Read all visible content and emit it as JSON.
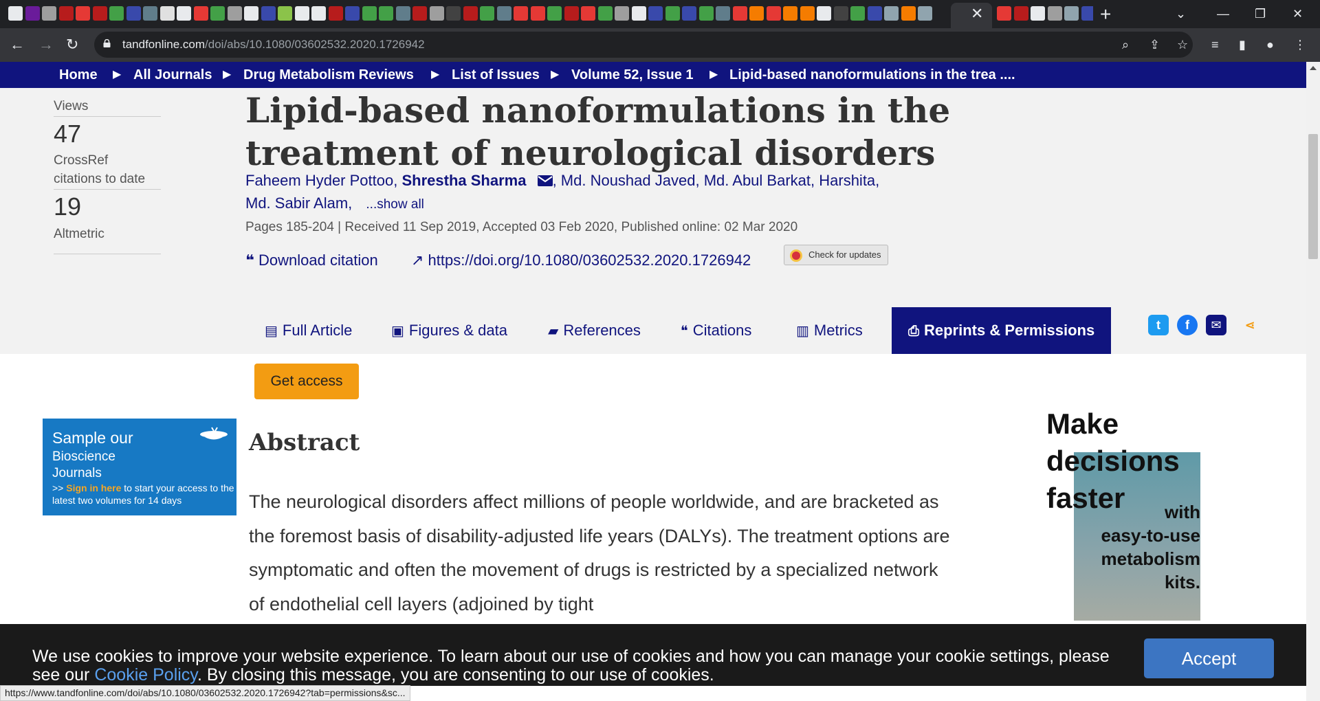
{
  "browser": {
    "tab_favicons": [
      "#e8eaed",
      "#6a1b9a",
      "#9e9e9e",
      "#b71c1c",
      "#e53935",
      "#b71c1c",
      "#43a047",
      "#3949ab",
      "#607d8b",
      "#e0e0e0",
      "#e8eaed",
      "#e53935",
      "#43a047",
      "#9e9e9e",
      "#e8eaed",
      "#3949ab",
      "#8bc34a",
      "#e8eaed",
      "#e8eaed",
      "#b71c1c",
      "#3949ab",
      "#43a047",
      "#43a047",
      "#607d8b",
      "#b71c1c",
      "#9e9e9e",
      "#424242",
      "#b71c1c",
      "#43a047",
      "#607d8b",
      "#e53935",
      "#e53935",
      "#43a047",
      "#b71c1c",
      "#e53935",
      "#43a047",
      "#9e9e9e",
      "#e8eaed",
      "#3949ab",
      "#43a047",
      "#3949ab",
      "#43a047",
      "#607d8b",
      "#e53935",
      "#f57c00",
      "#e53935",
      "#f57c00",
      "#f57c00",
      "#e8eaed",
      "#424242",
      "#43a047",
      "#3949ab",
      "#90a4ae",
      "#f57c00",
      "#90a4ae"
    ],
    "active_tab_close": "✕",
    "more_tab_favicons": [
      "#e53935",
      "#b71c1c",
      "#e8eaed",
      "#9e9e9e",
      "#90a4ae",
      "#3949ab"
    ],
    "new_tab": "+",
    "url_host": "tandfonline.com",
    "url_path": "/doi/abs/10.1080/03602532.2020.1726942"
  },
  "breadcrumb": [
    "Home",
    "All Journals",
    "Drug Metabolism Reviews",
    "List of Issues",
    "Volume 52, Issue 1",
    "Lipid-based nanoformulations in the trea ...."
  ],
  "metrics": {
    "views_label": "Views",
    "crossref_value": "47",
    "crossref_label_1": "CrossRef",
    "crossref_label_2": "citations to date",
    "altmetric_value": "19",
    "altmetric_label": "Altmetric"
  },
  "article": {
    "title": "Lipid-based nanoformulations in the treatment of neurological disorders",
    "authors": [
      "Faheem Hyder Pottoo,",
      "Shrestha Sharma",
      ", Md. Noushad Javed,",
      "Md. Abul Barkat,",
      "Harshita,",
      "Md. Sabir Alam,"
    ],
    "show_all": "...show all",
    "meta": "Pages 185-204 | Received 11 Sep 2019, Accepted 03 Feb 2020, Published online: 02 Mar 2020",
    "download_citation": "Download citation",
    "doi": "https://doi.org/10.1080/03602532.2020.1726942",
    "check_updates": "Check for updates"
  },
  "tabs": {
    "full_article": "Full Article",
    "figures": "Figures & data",
    "references": "References",
    "citations": "Citations",
    "metrics": "Metrics",
    "reprints": "Reprints & Permissions"
  },
  "social": {
    "twitter_color": "#1d9bf0",
    "facebook_color": "#1877f2",
    "email_color": "#10147e",
    "share_color": "#f39c12"
  },
  "get_access": "Get access",
  "promo": {
    "line1": "Sample our",
    "line2": "Bioscience",
    "line3": "Journals",
    "prefix": ">> ",
    "signin": "Sign in here",
    "rest": " to start your access to the latest two volumes for 14 days"
  },
  "abstract": {
    "heading": "Abstract",
    "text": "The neurological disorders affect millions of people worldwide, and are bracketed as the foremost basis of disability-adjusted life years (DALYs). The treatment options are symptomatic and often the movement of drugs is restricted by a specialized network of endothelial cell layers (adjoined by tight"
  },
  "ad": {
    "line1": "Make",
    "line2": "decisions",
    "line3": "faster",
    "line4": "with",
    "line5": "easy-to-use",
    "line6": "metabolism",
    "line7": "kits."
  },
  "cookie": {
    "text_before": "We use cookies to improve your website experience. To learn about our use of cookies and how you can manage your cookie settings, please see our ",
    "policy_link": "Cookie Policy",
    "text_after": ". By closing this message, you are consenting to our use of cookies.",
    "accept": "Accept"
  },
  "status_url": "https://www.tandfonline.com/doi/abs/10.1080/03602532.2020.1726942?tab=permissions&sc..."
}
